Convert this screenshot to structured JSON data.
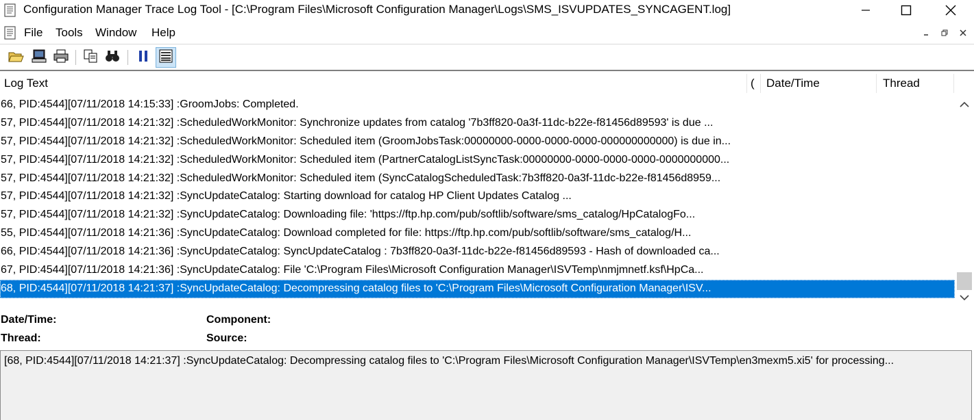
{
  "window": {
    "title": "Configuration Manager Trace Log Tool - [C:\\Program Files\\Microsoft Configuration Manager\\Logs\\SMS_ISVUPDATES_SYNCAGENT.log]",
    "app_icon": "log-document-icon"
  },
  "menu": {
    "items": [
      "File",
      "Tools",
      "Window",
      "Help"
    ]
  },
  "toolbar": {
    "buttons": [
      {
        "name": "open-icon",
        "active": false
      },
      {
        "name": "open-remote-icon",
        "active": false
      },
      {
        "name": "print-icon",
        "active": false
      },
      {
        "name": "copy-icon",
        "active": false
      },
      {
        "name": "find-icon",
        "active": false
      },
      {
        "name": "pause-icon",
        "active": false
      },
      {
        "name": "error-lookup-icon",
        "active": true
      }
    ]
  },
  "list": {
    "columns": [
      "Log Text",
      "(",
      "Date/Time",
      "Thread"
    ],
    "rows": [
      "66, PID:4544][07/11/2018 14:15:33] :GroomJobs: Completed.",
      "57, PID:4544][07/11/2018 14:21:32] :ScheduledWorkMonitor: Synchronize updates from catalog '7b3ff820-0a3f-11dc-b22e-f81456d89593' is due ...",
      "57, PID:4544][07/11/2018 14:21:32] :ScheduledWorkMonitor: Scheduled item (GroomJobsTask:00000000-0000-0000-0000-000000000000) is due in...",
      "57, PID:4544][07/11/2018 14:21:32] :ScheduledWorkMonitor: Scheduled item (PartnerCatalogListSyncTask:00000000-0000-0000-0000-0000000000...",
      "57, PID:4544][07/11/2018 14:21:32] :ScheduledWorkMonitor: Scheduled item (SyncCatalogScheduledTask:7b3ff820-0a3f-11dc-b22e-f81456d8959...",
      "57, PID:4544][07/11/2018 14:21:32] :SyncUpdateCatalog: Starting download for catalog HP Client Updates Catalog ...",
      "57, PID:4544][07/11/2018 14:21:32] :SyncUpdateCatalog: Downloading file: 'https://ftp.hp.com/pub/softlib/software/sms_catalog/HpCatalogFo...",
      "55, PID:4544][07/11/2018 14:21:36] :SyncUpdateCatalog: Download completed for file: https://ftp.hp.com/pub/softlib/software/sms_catalog/H...",
      "66, PID:4544][07/11/2018 14:21:36] :SyncUpdateCatalog: SyncUpdateCatalog : 7b3ff820-0a3f-11dc-b22e-f81456d89593 - Hash of downloaded ca...",
      "67, PID:4544][07/11/2018 14:21:36] :SyncUpdateCatalog: File 'C:\\Program Files\\Microsoft Configuration Manager\\ISVTemp\\nmjmnetf.ksf\\HpCa...",
      "68, PID:4544][07/11/2018 14:21:37] :SyncUpdateCatalog: Decompressing catalog files to 'C:\\Program Files\\Microsoft Configuration Manager\\ISV..."
    ],
    "selected_index": 10
  },
  "details": {
    "datetime_label": "Date/Time:",
    "thread_label": "Thread:",
    "component_label": "Component:",
    "source_label": "Source:",
    "message": "[68, PID:4544][07/11/2018 14:21:37] :SyncUpdateCatalog: Decompressing catalog files to 'C:\\Program Files\\Microsoft Configuration Manager\\ISVTemp\\en3mexm5.xi5' for processing..."
  },
  "colors": {
    "selection": "#0078d7",
    "toolbar_active": "#cce4f7",
    "message_bg": "#f0f0f0"
  }
}
